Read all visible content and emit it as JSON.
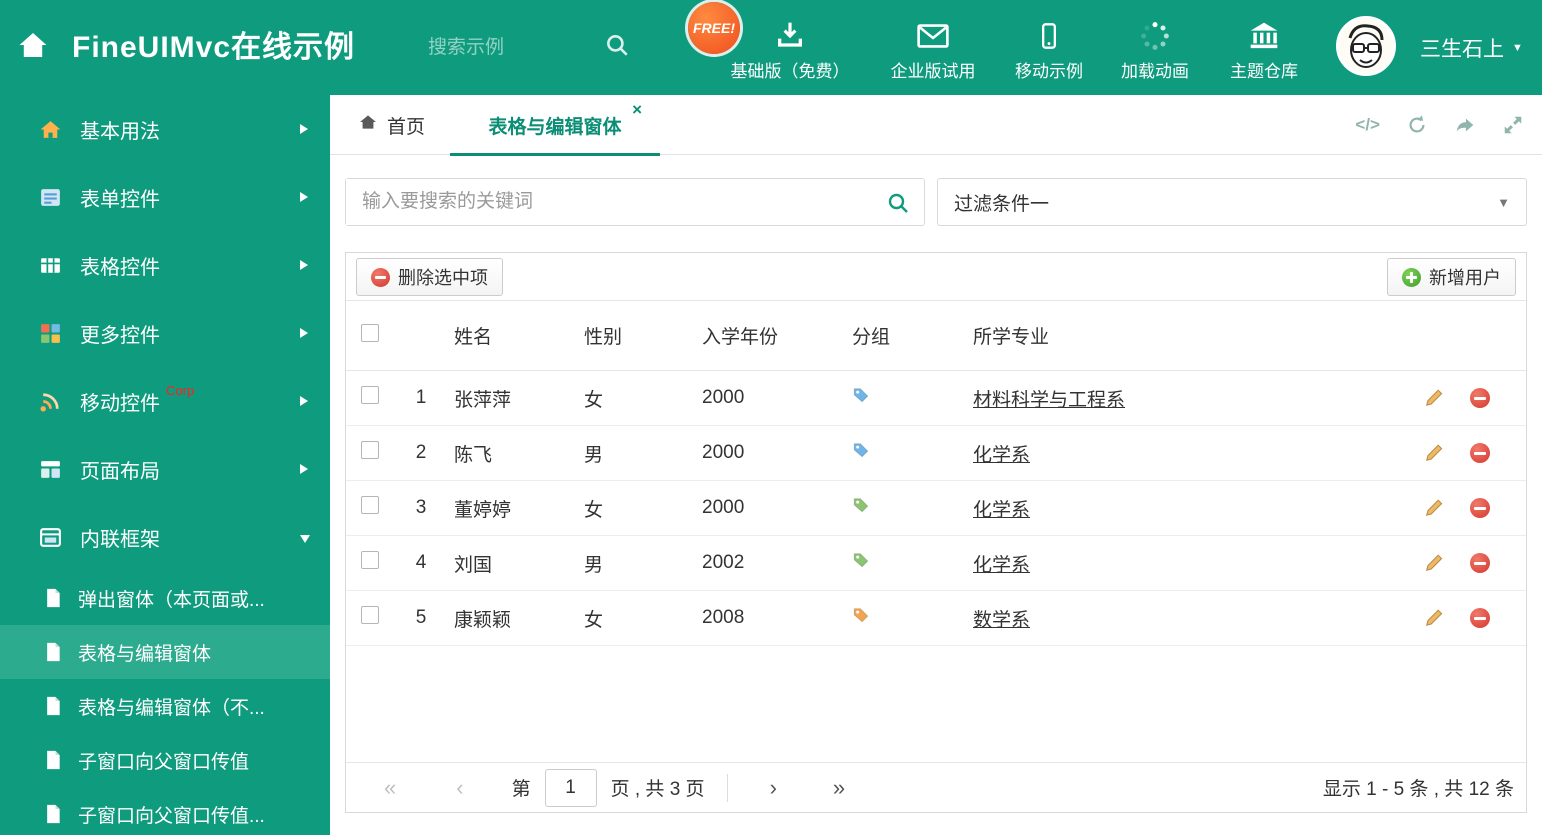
{
  "colors": {
    "primary_green": "#0f9b7e",
    "sidebar_active": "#2dab8f",
    "tab_active": "#0c8e76",
    "free_badge": "#f04e1d",
    "delete_red": "#d5372f",
    "add_green": "#3f9e2a",
    "corp_red": "#ff1f1f"
  },
  "header": {
    "title": "FineUIMvc在线示例",
    "search_placeholder": "搜索示例",
    "free_badge": "FREE!",
    "nav": [
      {
        "label": "基础版（免费）"
      },
      {
        "label": "企业版试用"
      },
      {
        "label": "移动示例"
      },
      {
        "label": "加载动画"
      },
      {
        "label": "主题仓库"
      }
    ],
    "user_name": "三生石上"
  },
  "sidebar": {
    "items": [
      {
        "label": "基本用法"
      },
      {
        "label": "表单控件"
      },
      {
        "label": "表格控件"
      },
      {
        "label": "更多控件"
      },
      {
        "label": "移动控件",
        "badge": "Corp"
      },
      {
        "label": "页面布局"
      },
      {
        "label": "内联框架"
      }
    ],
    "subitems": [
      {
        "label": "弹出窗体（本页面或..."
      },
      {
        "label": "表格与编辑窗体"
      },
      {
        "label": "表格与编辑窗体（不..."
      },
      {
        "label": "子窗口向父窗口传值"
      },
      {
        "label": "子窗口向父窗口传值..."
      }
    ]
  },
  "tabs": {
    "home_label": "首页",
    "active_label": "表格与编辑窗体"
  },
  "filter": {
    "search_placeholder": "输入要搜索的关键词",
    "dropdown_value": "过滤条件一"
  },
  "toolbar": {
    "delete_label": "删除选中项",
    "add_label": "新增用户"
  },
  "table": {
    "columns": [
      "姓名",
      "性别",
      "入学年份",
      "分组",
      "所学专业"
    ],
    "rows": [
      {
        "num": "1",
        "name": "张萍萍",
        "gender": "女",
        "year": "2000",
        "tag_color": "#6fb5e8",
        "major": "材料科学与工程系"
      },
      {
        "num": "2",
        "name": "陈飞",
        "gender": "男",
        "year": "2000",
        "tag_color": "#6fb5e8",
        "major": "化学系"
      },
      {
        "num": "3",
        "name": "董婷婷",
        "gender": "女",
        "year": "2000",
        "tag_color": "#8bc572",
        "major": "化学系"
      },
      {
        "num": "4",
        "name": "刘国",
        "gender": "男",
        "year": "2002",
        "tag_color": "#8bc572",
        "major": "化学系"
      },
      {
        "num": "5",
        "name": "康颖颖",
        "gender": "女",
        "year": "2008",
        "tag_color": "#f2a54e",
        "major": "数学系"
      }
    ]
  },
  "pagination": {
    "page_prefix": "第",
    "current_page": "1",
    "page_suffix": "页 , 共 3 页",
    "summary": "显示 1 - 5 条 , 共 12 条"
  },
  "icons": {
    "close": "×",
    "caret_down": "▼",
    "code": "</>",
    "pager_first": "«",
    "pager_prev": "‹",
    "pager_next": "›",
    "pager_last": "»"
  }
}
